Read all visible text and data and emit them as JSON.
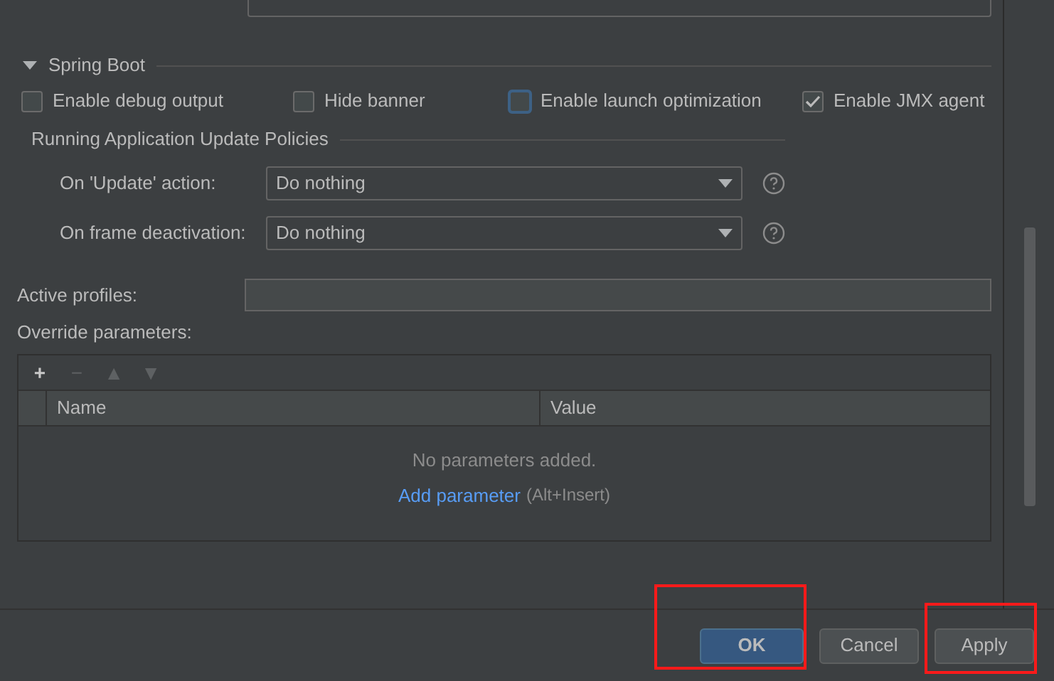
{
  "spring_boot": {
    "title": "Spring Boot",
    "expanded": true,
    "checkboxes": [
      {
        "label": "Enable debug output",
        "checked": false,
        "focused": false
      },
      {
        "label": "Hide banner",
        "checked": false,
        "focused": false
      },
      {
        "label": "Enable launch optimization",
        "checked": false,
        "focused": true
      },
      {
        "label": "Enable JMX agent",
        "checked": true,
        "focused": false
      }
    ],
    "policies": {
      "title": "Running Application Update Policies",
      "rows": [
        {
          "label": "On 'Update' action:",
          "value": "Do nothing"
        },
        {
          "label": "On frame deactivation:",
          "value": "Do nothing"
        }
      ]
    }
  },
  "active_profiles": {
    "label": "Active profiles:"
  },
  "override_parameters": {
    "label": "Override parameters:",
    "toolbar": [
      {
        "symbol": "+",
        "disabled": false
      },
      {
        "symbol": "−",
        "disabled": true
      },
      {
        "symbol": "▲",
        "disabled": true
      },
      {
        "symbol": "▼",
        "disabled": true
      }
    ],
    "columns": [
      "Name",
      "Value"
    ],
    "empty_text": "No parameters added.",
    "add_link": "Add parameter",
    "shortcut": "(Alt+Insert)"
  },
  "buttons": [
    {
      "label": "OK",
      "kind": "primary"
    },
    {
      "label": "Cancel",
      "kind": "normal"
    },
    {
      "label": "Apply",
      "kind": "normal"
    }
  ]
}
